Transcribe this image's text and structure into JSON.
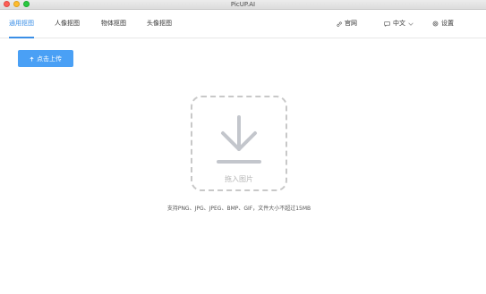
{
  "window": {
    "title": "PicUP.AI"
  },
  "nav": {
    "tabs": [
      {
        "label": "通用抠图",
        "active": true
      },
      {
        "label": "人像抠图",
        "active": false
      },
      {
        "label": "物体抠图",
        "active": false
      },
      {
        "label": "头像抠图",
        "active": false
      }
    ],
    "website_label": "官网",
    "language_label": "中文",
    "settings_label": "设置"
  },
  "upload": {
    "button_label": "点击上传"
  },
  "dropzone": {
    "label": "拖入图片",
    "hint": "支持PNG、JPG、JPEG、BMP、GIF，文件大小不超过15MB"
  },
  "colors": {
    "accent": "#3a8ee6",
    "button": "#4aa0f5",
    "dropzone_border": "#c8c8c8"
  },
  "icons": {
    "website": "link-icon",
    "language": "chat-bubble-icon",
    "settings": "gear-icon",
    "upload": "upload-arrow-icon",
    "dropzone": "download-arrow-icon"
  }
}
